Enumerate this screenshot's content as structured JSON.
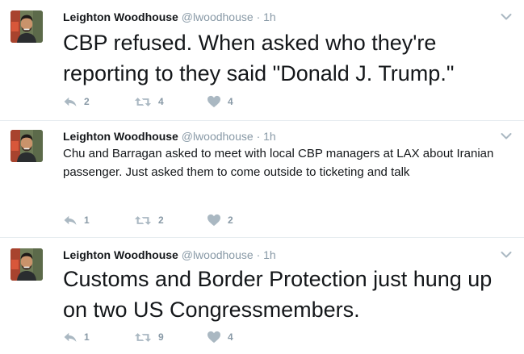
{
  "tweets": [
    {
      "author": "Leighton Woodhouse",
      "handle": "@lwoodhouse",
      "separator": "·",
      "time": "1h",
      "text": "CBP refused. When asked who they're reporting to they said \"Donald J. Trump.\"",
      "replies": "2",
      "retweets": "4",
      "likes": "4"
    },
    {
      "author": "Leighton Woodhouse",
      "handle": "@lwoodhouse",
      "separator": "·",
      "time": "1h",
      "text": "Chu and Barragan asked to meet with local CBP managers at LAX about Iranian passenger. Just asked them to come outside to ticketing and talk",
      "replies": "1",
      "retweets": "2",
      "likes": "2"
    },
    {
      "author": "Leighton Woodhouse",
      "handle": "@lwoodhouse",
      "separator": "·",
      "time": "1h",
      "text": "Customs and Border Protection just hung up on two US Congressmembers.",
      "replies": "1",
      "retweets": "9",
      "likes": "4"
    }
  ],
  "icons": {
    "reply": "reply-icon",
    "retweet": "retweet-icon",
    "like": "heart-icon",
    "more": "chevron-down-icon"
  },
  "colors": {
    "text": "#14171a",
    "muted": "#8899a6",
    "icon": "#aab8c2",
    "divider": "#e6ecf0"
  }
}
